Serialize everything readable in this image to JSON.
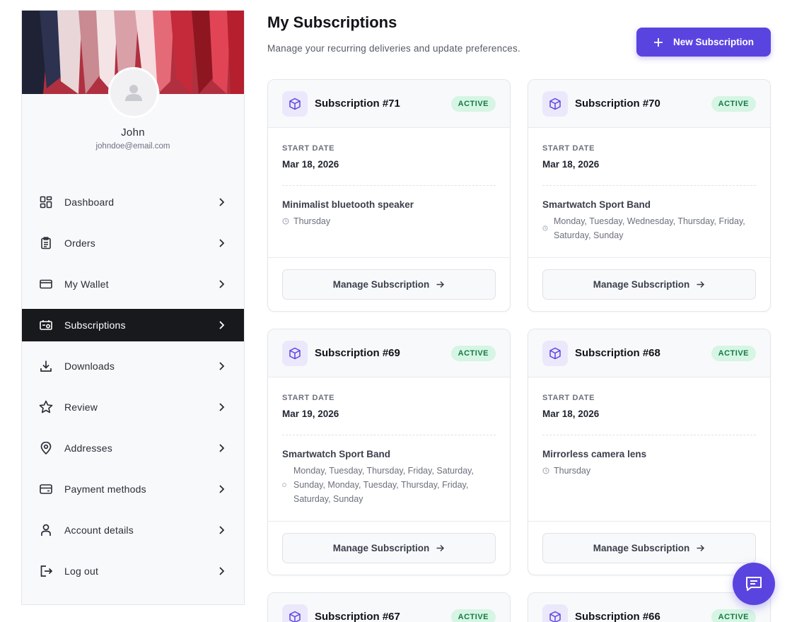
{
  "user": {
    "name": "John",
    "email": "johndoe@email.com"
  },
  "sidebar": {
    "items": [
      {
        "label": "Dashboard",
        "icon": "dashboard-icon"
      },
      {
        "label": "Orders",
        "icon": "clipboard-icon"
      },
      {
        "label": "My Wallet",
        "icon": "wallet-icon"
      },
      {
        "label": "Subscriptions",
        "icon": "subscriptions-icon",
        "active": true
      },
      {
        "label": "Downloads",
        "icon": "download-icon"
      },
      {
        "label": "Review",
        "icon": "star-icon"
      },
      {
        "label": "Addresses",
        "icon": "location-pin-icon"
      },
      {
        "label": "Payment methods",
        "icon": "credit-card-icon"
      },
      {
        "label": "Account details",
        "icon": "user-icon"
      },
      {
        "label": "Log out",
        "icon": "logout-icon"
      }
    ]
  },
  "header": {
    "title": "My Subscriptions",
    "subtitle": "Manage your recurring deliveries and update preferences.",
    "new_button": "New Subscription"
  },
  "cards": [
    {
      "title": "Subscription #71",
      "status": "ACTIVE",
      "start_label": "START DATE",
      "start_date": "Mar 18, 2026",
      "product": "Minimalist bluetooth speaker",
      "days": "Thursday",
      "button": "Manage Subscription"
    },
    {
      "title": "Subscription #70",
      "status": "ACTIVE",
      "start_label": "START DATE",
      "start_date": "Mar 18, 2026",
      "product": "Smartwatch Sport Band",
      "days": "Monday, Tuesday, Wednesday, Thursday, Friday, Saturday, Sunday",
      "button": "Manage Subscription"
    },
    {
      "title": "Subscription #69",
      "status": "ACTIVE",
      "start_label": "START DATE",
      "start_date": "Mar 19, 2026",
      "product": "Smartwatch Sport Band",
      "days": "Monday, Tuesday, Thursday, Friday, Saturday, Sunday, Monday, Tuesday, Thursday, Friday, Saturday, Sunday",
      "button": "Manage Subscription"
    },
    {
      "title": "Subscription #68",
      "status": "ACTIVE",
      "start_label": "START DATE",
      "start_date": "Mar 18, 2026",
      "product": "Mirrorless camera lens",
      "days": "Thursday",
      "button": "Manage Subscription"
    },
    {
      "title": "Subscription #67",
      "status": "ACTIVE"
    },
    {
      "title": "Subscription #66",
      "status": "ACTIVE"
    }
  ],
  "colors": {
    "accent": "#5a44e0",
    "active_nav": "#18191c",
    "badge_bg": "#d6f5e4",
    "badge_text": "#157a45"
  }
}
